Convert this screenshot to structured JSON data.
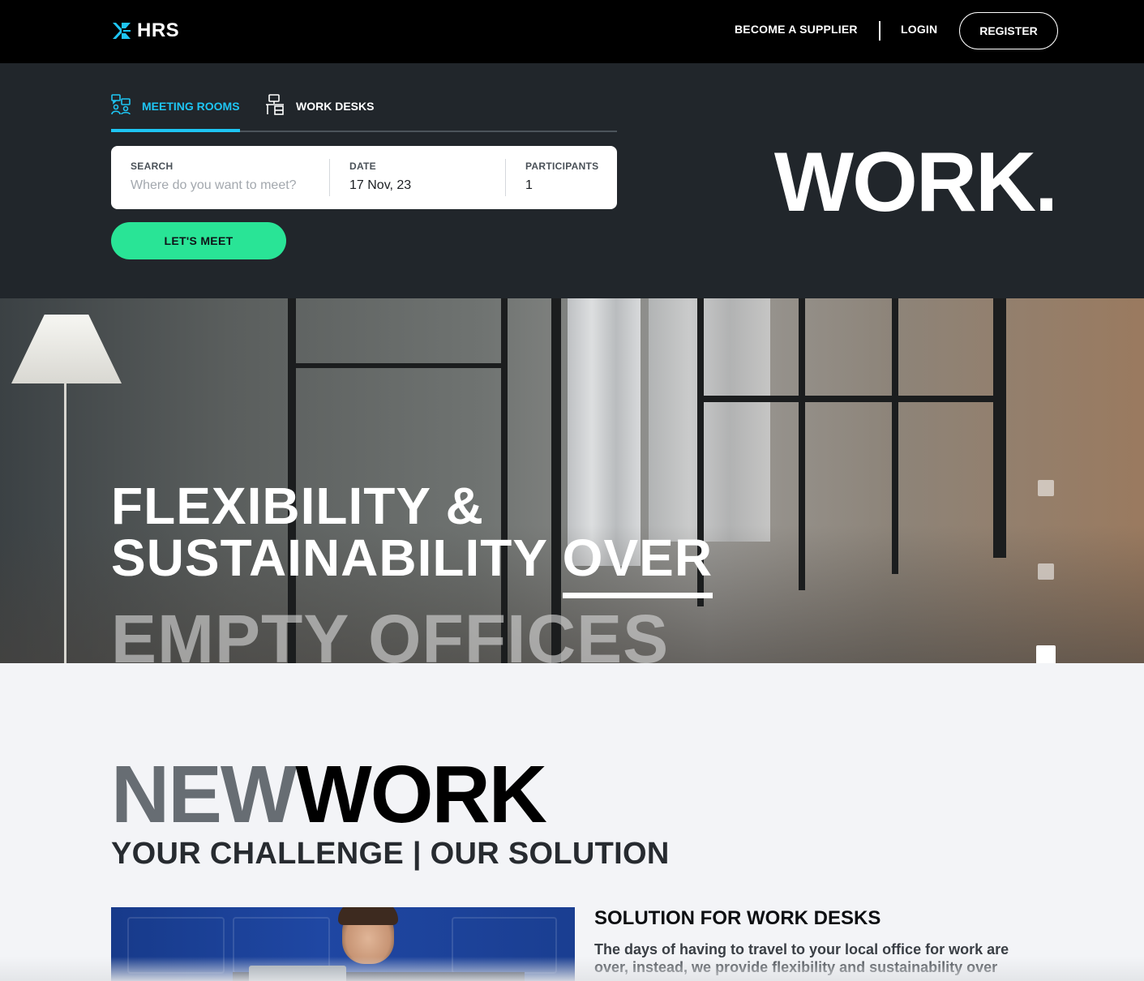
{
  "header": {
    "logo_text": "HRS",
    "nav": {
      "supplier": "BECOME A SUPPLIER",
      "login": "LOGIN",
      "register": "REGISTER"
    }
  },
  "search": {
    "tabs": [
      {
        "label": "MEETING ROOMS",
        "icon": "meeting-rooms-icon",
        "active": true
      },
      {
        "label": "WORK DESKS",
        "icon": "work-desk-icon",
        "active": false
      }
    ],
    "fields": {
      "search_label": "SEARCH",
      "search_placeholder": "Where do you want to meet?",
      "date_label": "DATE",
      "date_value": "17 Nov, 23",
      "participants_label": "PARTICIPANTS",
      "participants_value": "1"
    },
    "submit": "LET'S MEET",
    "headline": "WORK."
  },
  "hero": {
    "line1": "FLEXIBILITY &",
    "line2": "SUSTAINABILITY",
    "line2_highlight": "OVER",
    "line3": "EMPTY OFFICES",
    "slides": 3,
    "active_slide": 3
  },
  "newwork": {
    "new": "NEW",
    "work": "WORK",
    "subtitle": "YOUR CHALLENGE | OUR SOLUTION",
    "solution_title": "SOLUTION FOR WORK DESKS",
    "solution_text": "The days of having to travel to your local office for work are over, instead, we provide flexibility and sustainability over"
  },
  "colors": {
    "accent_blue": "#1ec5f3",
    "accent_green": "#29e496",
    "panel_dark": "#21262b"
  }
}
